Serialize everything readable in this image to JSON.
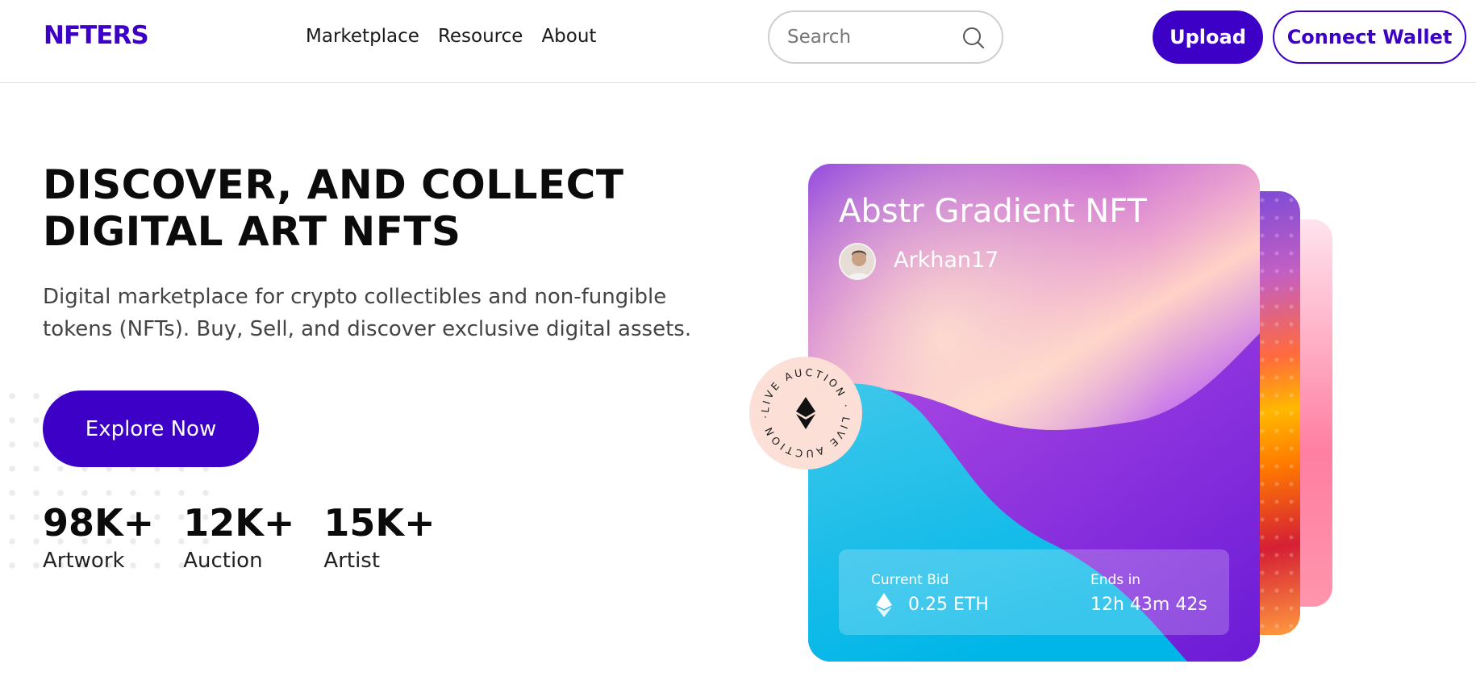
{
  "header": {
    "logo": "NFTERS",
    "nav": [
      "Marketplace",
      "Resource",
      "About"
    ],
    "search_placeholder": "Search",
    "upload_label": "Upload",
    "wallet_label": "Connect Wallet"
  },
  "hero": {
    "title_line1": "DISCOVER, AND COLLECT",
    "title_line2": "DIGITAL ART NFTS",
    "subtitle_line1": "Digital marketplace for crypto collectibles and non-fungible",
    "subtitle_line2": "tokens (NFTs). Buy, Sell, and discover exclusive digital assets.",
    "cta_label": "Explore Now",
    "stats": [
      {
        "value": "98K+",
        "label": "Artwork"
      },
      {
        "value": "12K+",
        "label": "Auction"
      },
      {
        "value": "15K+",
        "label": "Artist"
      }
    ]
  },
  "card": {
    "title": "Abstr Gradient NFT",
    "author": "Arkhan17",
    "current_bid_label": "Current Bid",
    "current_bid_value": "0.25 ETH",
    "ends_label": "Ends in",
    "ends_value": "12h 43m 42s"
  },
  "badge": {
    "text": "LIVE AUCTION · LIVE AUCTION · "
  },
  "colors": {
    "brand": "#3c00c7",
    "badge_bg": "#fce0d8"
  },
  "icons": {
    "search": "search-icon",
    "eth": "ethereum-icon"
  }
}
